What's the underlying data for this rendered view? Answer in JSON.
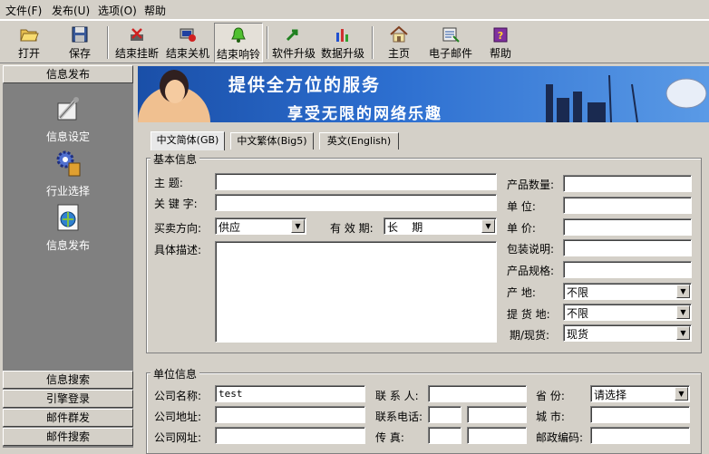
{
  "menu": [
    "文件(F)",
    "发布(U)",
    "选项(O)",
    "帮助"
  ],
  "toolbar": [
    {
      "label": "打开",
      "icon": "folder-open-icon"
    },
    {
      "label": "保存",
      "icon": "floppy-disk-icon"
    },
    {
      "label": "结束挂断",
      "icon": "hangup-icon"
    },
    {
      "label": "结束关机",
      "icon": "shutdown-icon"
    },
    {
      "label": "结束响铃",
      "icon": "bell-icon"
    },
    {
      "label": "软件升级",
      "icon": "upgrade-arrow-icon"
    },
    {
      "label": "数据升级",
      "icon": "bar-chart-icon"
    },
    {
      "label": "主页",
      "icon": "home-icon"
    },
    {
      "label": "电子邮件",
      "icon": "email-icon"
    },
    {
      "label": "帮助",
      "icon": "help-book-icon"
    }
  ],
  "sidebar": {
    "top_header": "信息发布",
    "items": [
      {
        "label": "信息设定",
        "icon": "settings-tools-icon"
      },
      {
        "label": "行业选择",
        "icon": "gear-industry-icon"
      },
      {
        "label": "信息发布",
        "icon": "publish-globe-icon"
      }
    ],
    "bottom_headers": [
      "信息搜索",
      "引擎登录",
      "邮件群发",
      "邮件搜索"
    ]
  },
  "banner": {
    "line1": "提供全方位的服务",
    "line2": "享受无限的网络乐趣"
  },
  "tabs": [
    "中文简体(GB)",
    "中文繁体(Big5)",
    "英文(English)"
  ],
  "basic": {
    "title": "基本信息",
    "subject_label": "主    题:",
    "keyword_label": "关 键 字:",
    "direction_label": "买卖方向:",
    "direction_value": "供应",
    "validity_label": "有 效 期:",
    "validity_value": "长    期",
    "desc_label": "具体描述:",
    "qty_label": "产品数量:",
    "unit_label": "单    位:",
    "price_label": "单    价:",
    "pack_label": "包装说明:",
    "spec_label": "产品规格:",
    "origin_label": "产    地:",
    "origin_value": "不限",
    "delivery_label": "提 货 地:",
    "delivery_value": "不限",
    "term_label": "期/现货:",
    "term_value": "现货"
  },
  "company": {
    "title": "单位信息",
    "name_label": "公司名称:",
    "name_value": "test",
    "contact_label": "联 系 人:",
    "province_label": "省    份:",
    "province_value": "请选择",
    "address_label": "公司地址:",
    "phone_label": "联系电话:",
    "city_label": "城    市:",
    "website_label": "公司网址:",
    "fax_label": "传    真:",
    "zip_label": "邮政编码:"
  }
}
